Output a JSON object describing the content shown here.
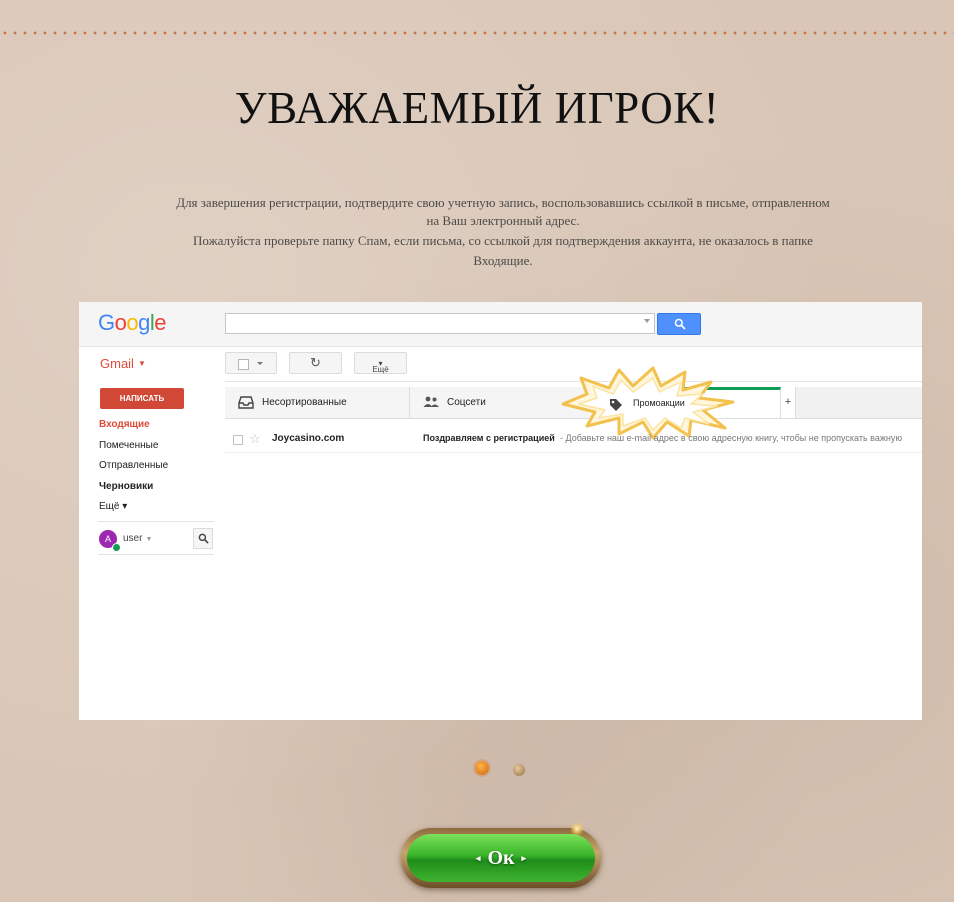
{
  "page": {
    "title": "УВАЖАЕМЫЙ ИГРОК!",
    "description_lines": [
      "Для завершения регистрации, подтвердите свою учетную запись, воспользовавшись ссылкой в письме, отправленном",
      "на Ваш электронный адрес.",
      "Пожалуйста проверьте папку Спам, если письма, со ссылкой для подтверждения аккаунта, не оказалось в папке",
      "Входящие."
    ],
    "ok_button_label": "Ок"
  },
  "gmail": {
    "logo_letters": [
      "G",
      "o",
      "o",
      "g",
      "l",
      "e"
    ],
    "app_label": "Gmail",
    "more_button": "Ещё",
    "compose_button": "НАПИСАТЬ",
    "sidebar": {
      "items": [
        {
          "label": "Входящие",
          "state": "active"
        },
        {
          "label": "Помеченные"
        },
        {
          "label": "Отправленные"
        },
        {
          "label": "Черновики",
          "state": "bold"
        },
        {
          "label": "Ещё ▾"
        }
      ],
      "user_initial": "A",
      "user_name": "user"
    },
    "tabs": [
      {
        "label": "Несортированные",
        "icon": "inbox-icon"
      },
      {
        "label": "Соцсети",
        "icon": "people-icon"
      },
      {
        "label": "Промоакции",
        "icon": "tag-icon",
        "highlighted": true
      }
    ],
    "add_tab": "+",
    "email": {
      "sender": "Joycasino.com",
      "subject": "Поздравляем с регистрацией",
      "snippet": " - Добавьте наш e-mail адрес в свою адресную книгу, чтобы не пропускать важную"
    }
  },
  "carousel": {
    "total": 2,
    "active_index": 0
  },
  "colors": {
    "background": "#d9c6b6",
    "dotted_line": "#c9744a",
    "gmail_red": "#dd4b39",
    "compose_red": "#d14836",
    "search_blue": "#4d90fe",
    "ok_green": "#39b32a",
    "dot_active": "#e07b1f"
  }
}
